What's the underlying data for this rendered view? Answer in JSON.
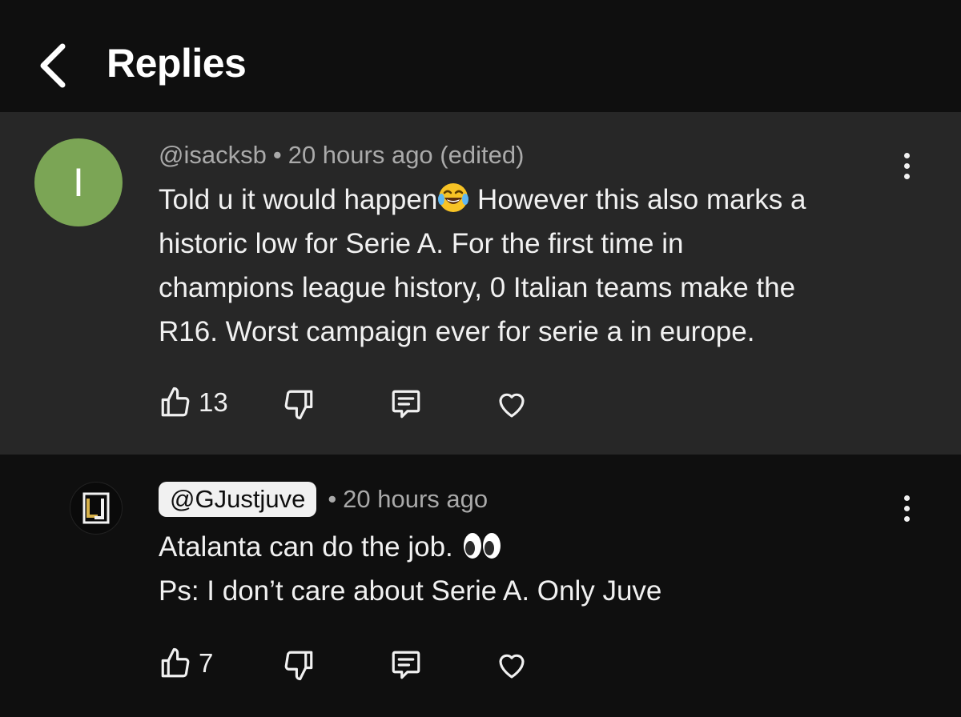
{
  "header": {
    "title": "Replies"
  },
  "comment": {
    "avatar_letter": "I",
    "avatar_color": "#7ba555",
    "handle": "@isacksb",
    "separator": "•",
    "time": "20 hours ago (edited)",
    "text_lines": [
      "Told u it would happen",
      "However this also marks a",
      "historic low for Serie A. For the first time in",
      "champions league history, 0 Italian teams make the",
      "R16. Worst campaign ever for serie a in europe."
    ],
    "likes": "13"
  },
  "reply": {
    "handle": "@GJustjuve",
    "separator": "•",
    "time": "20 hours ago",
    "text_lines": [
      "Atalanta can do the job.",
      "Ps: I don’t care about Serie A. Only Juve"
    ],
    "likes": "7"
  },
  "icons": {
    "back": "chevron-left-icon",
    "like": "thumbs-up-icon",
    "dislike": "thumbs-down-icon",
    "reply": "comment-icon",
    "heart": "heart-icon",
    "more": "more-vertical-icon"
  }
}
